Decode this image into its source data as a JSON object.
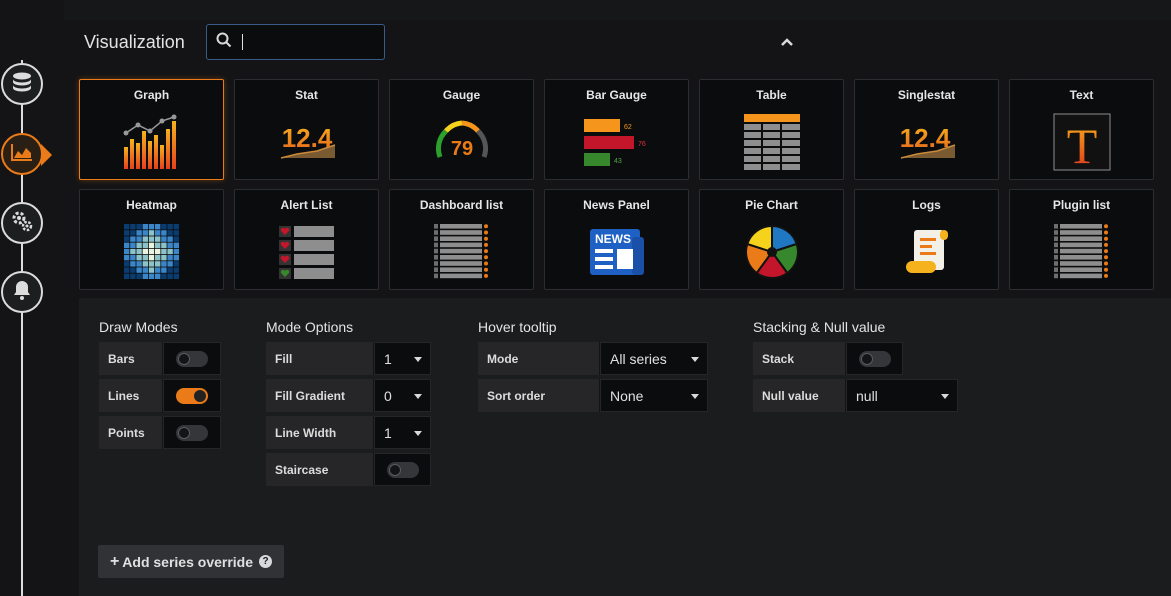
{
  "viz": {
    "title": "Visualization",
    "search_placeholder": "",
    "search_value": ""
  },
  "tiles": [
    {
      "label": "Graph",
      "icon": "graph-icon"
    },
    {
      "label": "Stat",
      "icon": "stat-icon",
      "value_text": "12.4"
    },
    {
      "label": "Gauge",
      "icon": "gauge-icon",
      "value_text": "79"
    },
    {
      "label": "Bar Gauge",
      "icon": "bar-gauge-icon",
      "values": [
        "62",
        "76",
        "43"
      ]
    },
    {
      "label": "Table",
      "icon": "table-icon"
    },
    {
      "label": "Singlestat",
      "icon": "singlestat-icon",
      "value_text": "12.4"
    },
    {
      "label": "Text",
      "icon": "text-icon",
      "glyph": "T"
    },
    {
      "label": "Heatmap",
      "icon": "heatmap-icon"
    },
    {
      "label": "Alert List",
      "icon": "alert-list-icon"
    },
    {
      "label": "Dashboard list",
      "icon": "dashboard-list-icon"
    },
    {
      "label": "News Panel",
      "icon": "news-icon",
      "badge": "NEWS"
    },
    {
      "label": "Pie Chart",
      "icon": "pie-chart-icon"
    },
    {
      "label": "Logs",
      "icon": "logs-icon"
    },
    {
      "label": "Plugin list",
      "icon": "plugin-list-icon"
    }
  ],
  "draw_modes": {
    "title": "Draw Modes",
    "bars": {
      "label": "Bars",
      "on": false
    },
    "lines": {
      "label": "Lines",
      "on": true
    },
    "points": {
      "label": "Points",
      "on": false
    }
  },
  "mode_options": {
    "title": "Mode Options",
    "fill": {
      "label": "Fill",
      "value": "1"
    },
    "fill_gradient": {
      "label": "Fill Gradient",
      "value": "0"
    },
    "line_width": {
      "label": "Line Width",
      "value": "1"
    },
    "staircase": {
      "label": "Staircase",
      "on": false
    }
  },
  "hover_tooltip": {
    "title": "Hover tooltip",
    "mode": {
      "label": "Mode",
      "value": "All series"
    },
    "sort_order": {
      "label": "Sort order",
      "value": "None"
    }
  },
  "stacking": {
    "title": "Stacking & Null value",
    "stack": {
      "label": "Stack",
      "on": false
    },
    "null_value": {
      "label": "Null value",
      "value": "null"
    }
  },
  "add_override": {
    "label": "Add series override"
  },
  "colors": {
    "accent": "#eb7b18",
    "panel": "#141416",
    "options_bg": "#1b1c1e"
  }
}
